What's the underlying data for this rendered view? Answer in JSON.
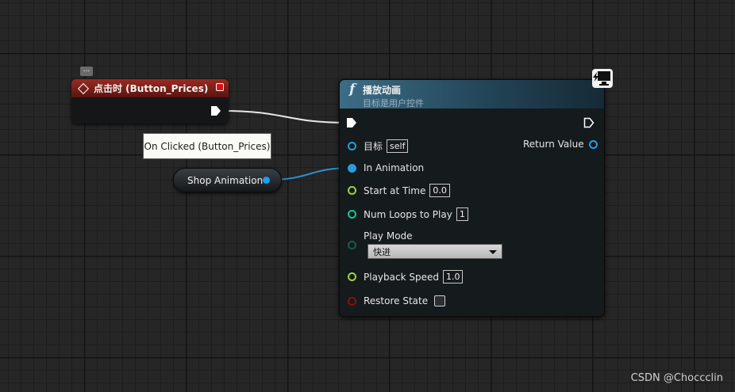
{
  "event_node": {
    "title": "点击时 (Button_Prices)",
    "comment_badge": "...",
    "tooltip": "On Clicked (Button_Prices)"
  },
  "variable_node": {
    "label": "Shop Animation"
  },
  "function_node": {
    "title": "播放动画",
    "subtitle": "目标是用户控件",
    "icon": "function-f-icon",
    "pins": {
      "target": {
        "label": "目标",
        "value": "self"
      },
      "return_value": {
        "label": "Return Value"
      },
      "in_animation": {
        "label": "In Animation"
      },
      "start_at_time": {
        "label": "Start at Time",
        "value": "0.0"
      },
      "num_loops": {
        "label": "Num Loops to Play",
        "value": "1"
      },
      "play_mode": {
        "label": "Play Mode",
        "selected": "快进"
      },
      "playback_speed": {
        "label": "Playback Speed",
        "value": "1.0"
      },
      "restore_state": {
        "label": "Restore State",
        "checked": false
      }
    }
  },
  "watermark": "CSDN @Choccclin",
  "colors": {
    "event_header": "#8a231c",
    "function_header": "#3c6d86",
    "object_pin": "#2a9bdf",
    "float_pin": "#9ed23b",
    "int_pin": "#17c39a",
    "enum_pin": "#175c4d",
    "bool_pin": "#8a1010"
  }
}
